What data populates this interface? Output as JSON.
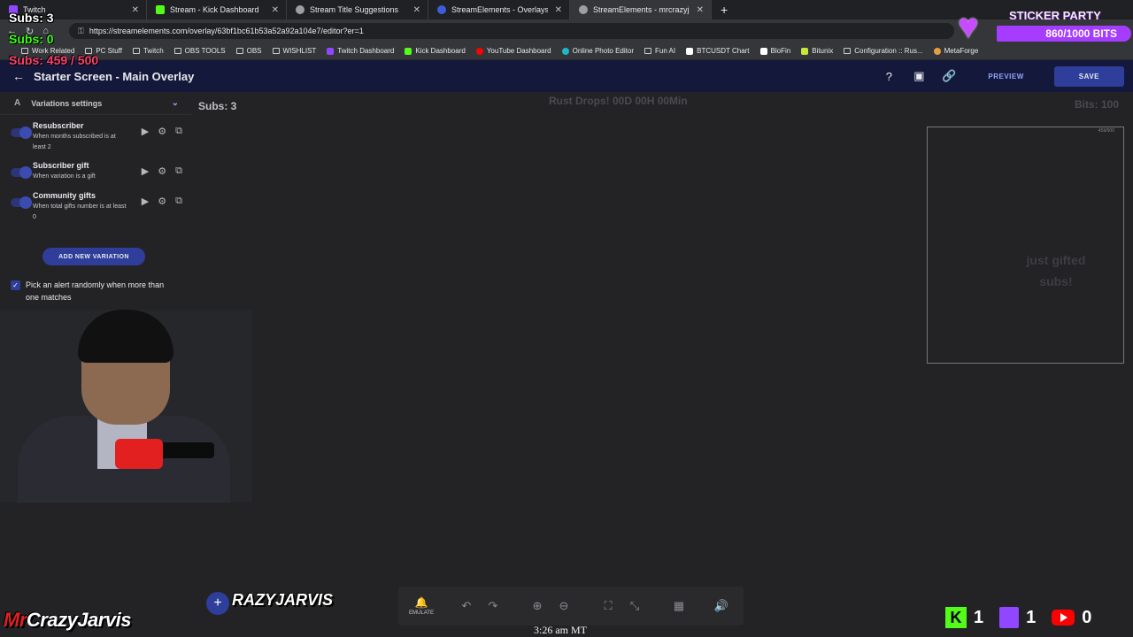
{
  "browser": {
    "tabs": [
      {
        "label": "Twitch",
        "color": "#9146ff"
      },
      {
        "label": "Stream - Kick Dashboard",
        "color": "#53fc18"
      },
      {
        "label": "Stream Title Suggestions",
        "color": "#9aa0a6"
      },
      {
        "label": "StreamElements - Overlays",
        "color": "#3e5bdb"
      },
      {
        "label": "StreamElements - mrcrazyjarvis",
        "color": "#9aa0a6"
      }
    ],
    "url": "https://streamelements.com/overlay/63bf1bc61b53a52a92a104e7/editor?er=1",
    "bookmarks": [
      {
        "label": "Work Related",
        "icon": "folder-icon"
      },
      {
        "label": "PC Stuff",
        "icon": "folder-icon"
      },
      {
        "label": "Twitch",
        "icon": "folder-icon"
      },
      {
        "label": "OBS TOOLS",
        "icon": "folder-icon"
      },
      {
        "label": "OBS",
        "icon": "folder-icon"
      },
      {
        "label": "WISHLIST",
        "icon": "folder-icon"
      },
      {
        "label": "Twitch Dashboard",
        "icon": "twitch-icon"
      },
      {
        "label": "Kick Dashboard",
        "icon": "kick-icon"
      },
      {
        "label": "YouTube Dashboard",
        "icon": "youtube-icon"
      },
      {
        "label": "Online Photo Editor",
        "icon": "photo-editor-icon"
      },
      {
        "label": "Fun AI",
        "icon": "folder-icon"
      },
      {
        "label": "BTCUSDT Chart",
        "icon": "tradingview-icon"
      },
      {
        "label": "BloFin",
        "icon": "blofin-icon"
      },
      {
        "label": "Bitunix",
        "icon": "bitunix-icon"
      },
      {
        "label": "Configuration :: Rus...",
        "icon": "page-icon"
      },
      {
        "label": "MetaForge",
        "icon": "metaforge-icon"
      }
    ]
  },
  "header": {
    "title": "Starter Screen - Main Overlay",
    "preview_label": "PREVIEW",
    "save_label": "SAVE"
  },
  "sidebar": {
    "section_title": "Variations settings",
    "variations": [
      {
        "title": "Resubscriber",
        "desc": "When months subscribed is at least 2"
      },
      {
        "title": "Subscriber gift",
        "desc": "When variation is a gift"
      },
      {
        "title": "Community gifts",
        "desc": "When total gifts number is at least 0"
      }
    ],
    "add_label": "ADD NEW VARIATION",
    "random_label": "Pick an alert randomly when more than one matches"
  },
  "canvas": {
    "subs_label": "Subs: 3",
    "rust_label": "Rust Drops! 00D 00H 00Min",
    "bits_label": "Bits: 100",
    "alert_text": "just gifted subs!",
    "alert_count": "459/500"
  },
  "toolbar": {
    "emulate_label": "EMULATE"
  },
  "overlay": {
    "subs_top": "Subs: 3",
    "subs_green": "Subs: 0",
    "subs_goal": "Subs: 459 / 500",
    "sticker_title": "STICKER PARTY",
    "sticker_progress": "860/1000 BITS",
    "brand_left_prefix": "Mr",
    "brand_left_rest": "CrazyJarvis",
    "brand_mid": "RAZYJARVIS",
    "clock": "3:26 am MT",
    "kick_count": "1",
    "twitch_count": "1",
    "youtube_count": "0"
  }
}
